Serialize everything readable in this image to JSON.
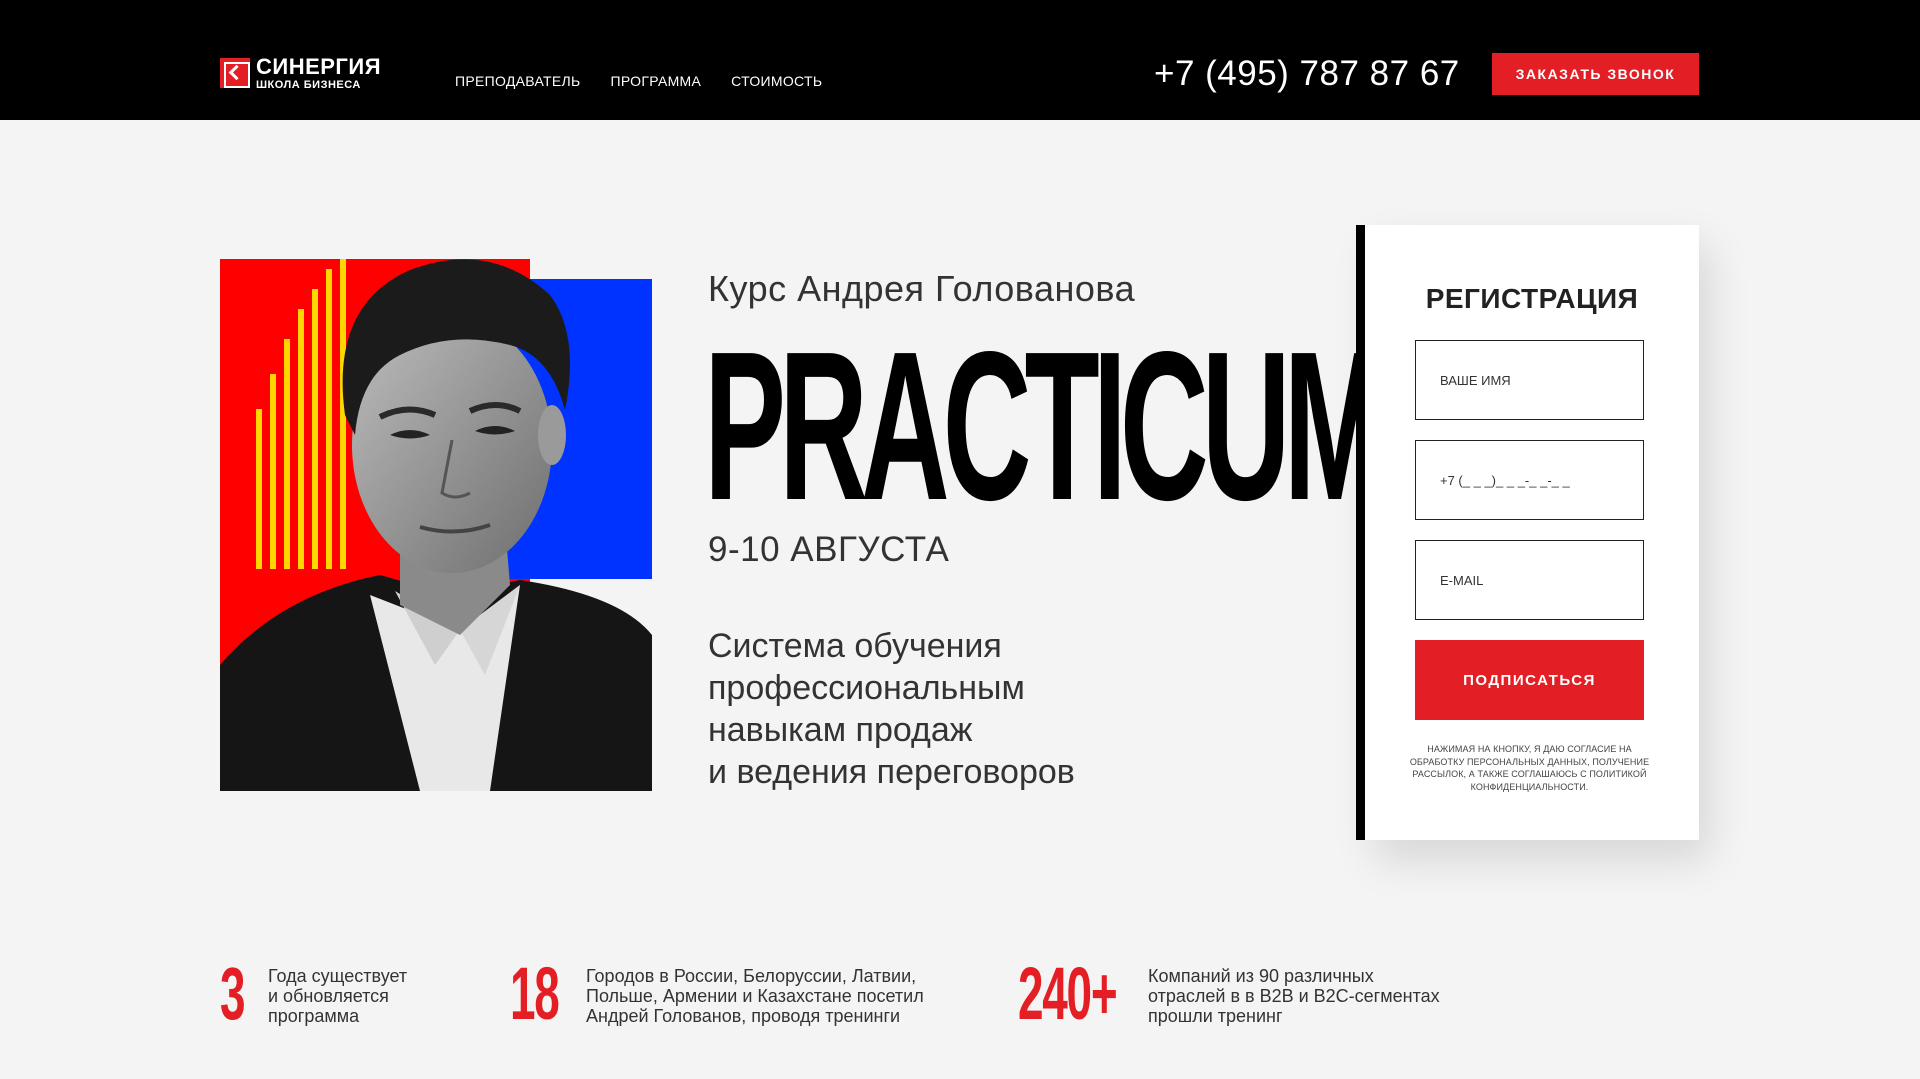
{
  "header": {
    "logo": {
      "title": "СИНЕРГИЯ",
      "subtitle": "ШКОЛА БИЗНЕСА"
    },
    "nav": [
      {
        "label": "ПРЕПОДАВАТЕЛЬ"
      },
      {
        "label": "ПРОГРАММА"
      },
      {
        "label": "СТОИМОСТЬ"
      }
    ],
    "phone": "+7 (495) 787 87 67",
    "call_button": "ЗАКАЗАТЬ ЗВОНОК"
  },
  "hero": {
    "subtitle": "Курс Андрея Голованова",
    "title": "PRACTICUM",
    "date": "9-10 АВГУСТА",
    "description": "Система обучения\nпрофессиональным\nнавыкам продаж\nи ведения переговоров"
  },
  "registration": {
    "title": "РЕГИСТРАЦИЯ",
    "name_placeholder": "ВАШЕ ИМЯ",
    "phone_placeholder": "+7 (_ _ _)_ _ _-_ _-_ _",
    "email_placeholder": "E-MAIL",
    "submit": "ПОДПИСАТЬСЯ",
    "note": "Нажимая на кнопку, я даю согласие на обработку персональных данных, получение рассылок, а также соглашаюсь с политикой конфиденциальности."
  },
  "stats": [
    {
      "number": "3",
      "text": "Года существует\nи обновляется\nпрограмма"
    },
    {
      "number": "18",
      "text": "Городов в России, Белоруссии, Латвии,\nПольше, Армении и Казахстане посетил\nАндрей Голованов, проводя тренинги"
    },
    {
      "number": "240+",
      "text": "Компаний из 90 различных\nотраслей в в B2B и B2C-сегментах\nпрошли тренинг"
    }
  ],
  "colors": {
    "accent": "#e31e24",
    "header_bg": "#000000",
    "page_bg": "#f4f4f4",
    "photo_blue": "#0033ff",
    "photo_yellow": "#ffd600"
  }
}
